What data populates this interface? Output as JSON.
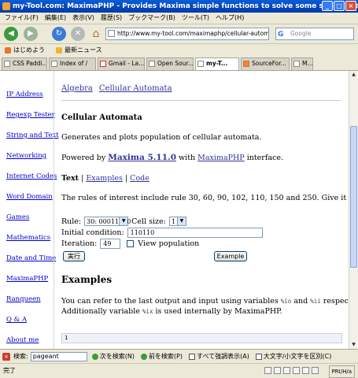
{
  "window": {
    "title": "my-Tool.com: MaximaPHP - Provides Maxima simple functions to solve some specific tasks in mathematics. - Cellular Automata"
  },
  "menu": [
    "ファイル(F)",
    "編集(E)",
    "表示(V)",
    "履歴(S)",
    "ブックマーク(B)",
    "ツール(T)",
    "ヘルプ(H)"
  ],
  "nav": {
    "url": "http://www.my-tool.com/maximaphp/cellular-automata",
    "search_placeholder": "Google"
  },
  "bookmarks": [
    {
      "label": "はじめよう",
      "color": "#e9732f"
    },
    {
      "label": "最新ニュース",
      "color": "#f2b430"
    }
  ],
  "tabs": [
    {
      "label": "CSS Paddi...",
      "active": false
    },
    {
      "label": "Index of /",
      "active": false
    },
    {
      "label": "Gmail - La...",
      "active": false
    },
    {
      "label": "Open Sour...",
      "active": false
    },
    {
      "label": "my-T...",
      "active": true
    },
    {
      "label": "SourceFor...",
      "active": false
    },
    {
      "label": "M...",
      "active": false
    }
  ],
  "sidebar": [
    "IP Address",
    "Regexp Tester",
    "String and Text",
    "Networking",
    "Internet Codes",
    "Word Domain",
    "Games",
    "Mathematics",
    "Date and Time",
    "MaximaPHP",
    "Ranqueen",
    "Q & A",
    "About me"
  ],
  "breadcrumbs": [
    "Algebra",
    "Cellular Automata"
  ],
  "page": {
    "heading": "Cellular Automata",
    "description": "Generates and plots population of cellular automata.",
    "powered_prefix": "Powered by ",
    "maxima_link": "Maxima 5.11.0",
    "powered_mid": " with ",
    "maximaphp_link": "MaximaPHP",
    "powered_suffix": " interface.",
    "text_tab": "Text",
    "examples_tab": "Examples",
    "code_tab": "Code",
    "sep": " | ",
    "rules_text": "The rules of interest include rule 30, 60, 90, 102, 110, 150 and 250. Give it a try!"
  },
  "form": {
    "rule_label": "Rule:",
    "rule_value": "30: 00011110",
    "cellsize_label": "Cell size:",
    "cellsize_value": "1",
    "initial_label": "Initial condition:",
    "initial_value": "110110",
    "iteration_label": "Iteration:",
    "iteration_value": "49",
    "view_population_label": "View population",
    "run_button": "実行",
    "example_button": "Example"
  },
  "examples": {
    "heading": "Examples",
    "line1_prefix": "You can refer to the last output and input using variables ",
    "var_o": "%io",
    "line1_mid": " and ",
    "var_i": "%ii",
    "line1_suffix": " respectively.",
    "line2_prefix": "Additionally variable ",
    "var_x": "%ix",
    "line2_suffix": " is used internally by MaximaPHP.",
    "code_value": "1"
  },
  "findbar": {
    "label": "検索:",
    "value": "pageant",
    "next": "次を検索(N)",
    "prev": "前を検索(P)",
    "highlight": "すべて強調表示(A)",
    "matchcase": "大文字/小文字を区別(C)"
  },
  "status": {
    "text": "完了",
    "right": "PRI/H/a"
  }
}
